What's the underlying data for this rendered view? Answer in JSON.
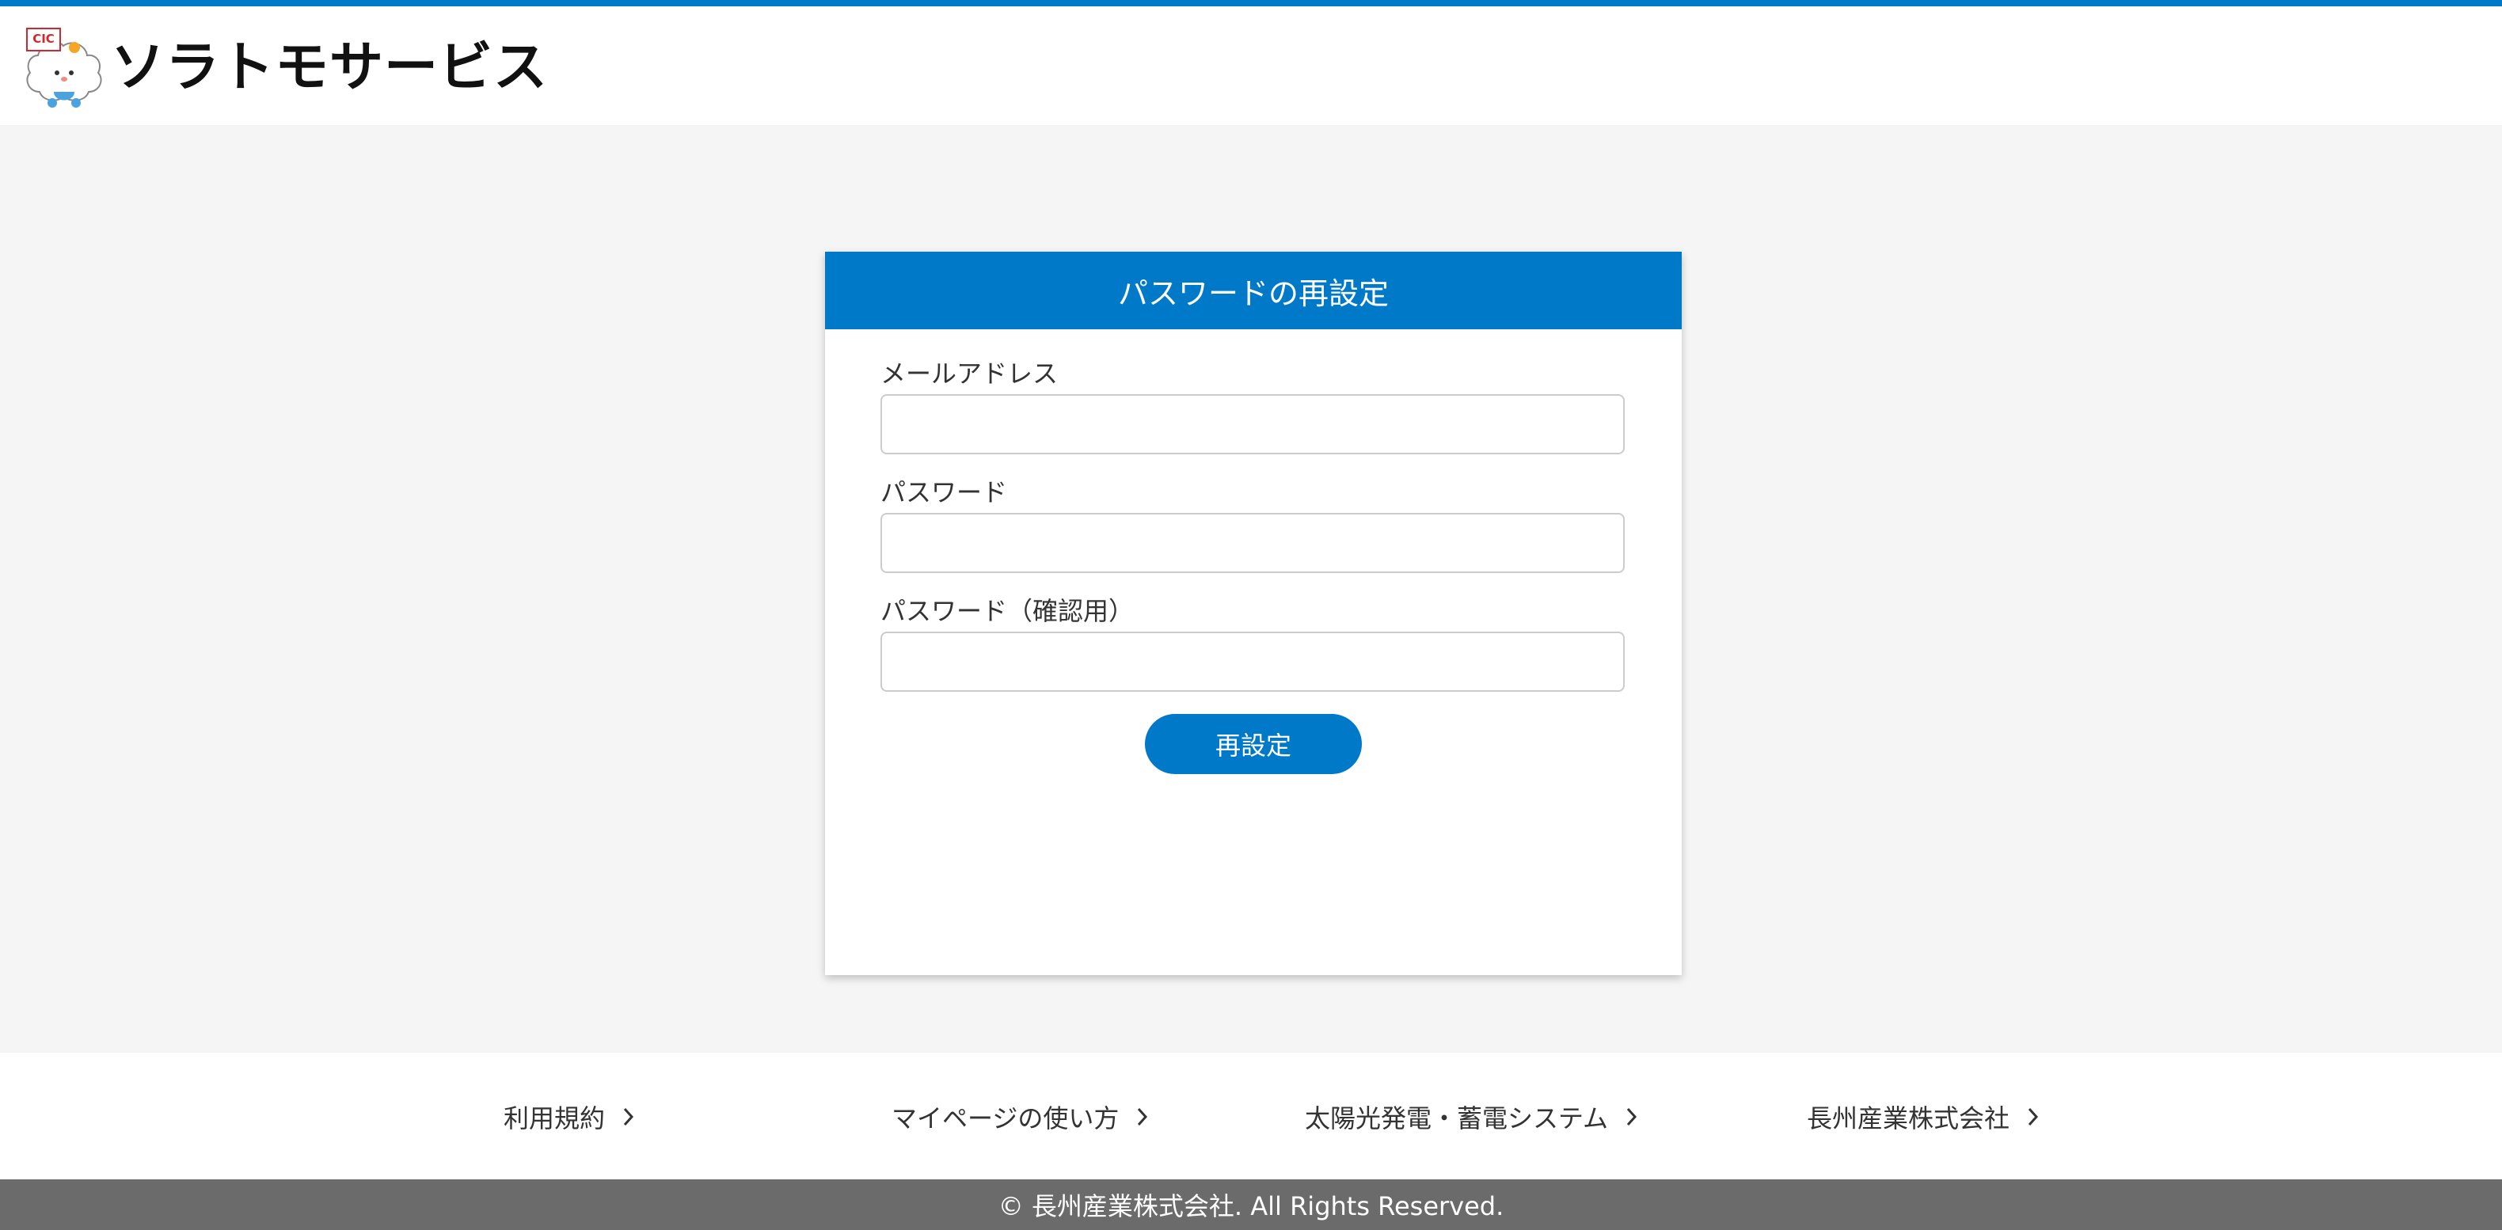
{
  "header": {
    "logo_text": "ソラトモサービス",
    "logo_badge": "CIC"
  },
  "card": {
    "title": "パスワードの再設定",
    "fields": [
      {
        "label": "メールアドレス",
        "value": "",
        "placeholder": ""
      },
      {
        "label": "パスワード",
        "value": "",
        "placeholder": ""
      },
      {
        "label": "パスワード（確認用）",
        "value": "",
        "placeholder": ""
      }
    ],
    "submit_label": "再設定"
  },
  "footer": {
    "links": [
      {
        "label": "利用規約"
      },
      {
        "label": "マイページの使い方"
      },
      {
        "label": "太陽光発電・蓄電システム"
      },
      {
        "label": "長州産業株式会社"
      }
    ],
    "copyright": "© 長州産業株式会社. All Rights Reserved."
  },
  "colors": {
    "accent": "#0079c8",
    "footer_bar": "#6b6b6b",
    "background": "#f5f5f5"
  },
  "icons": {
    "logo": "mascot-logo-icon",
    "link_arrow": "chevron-right-icon"
  }
}
